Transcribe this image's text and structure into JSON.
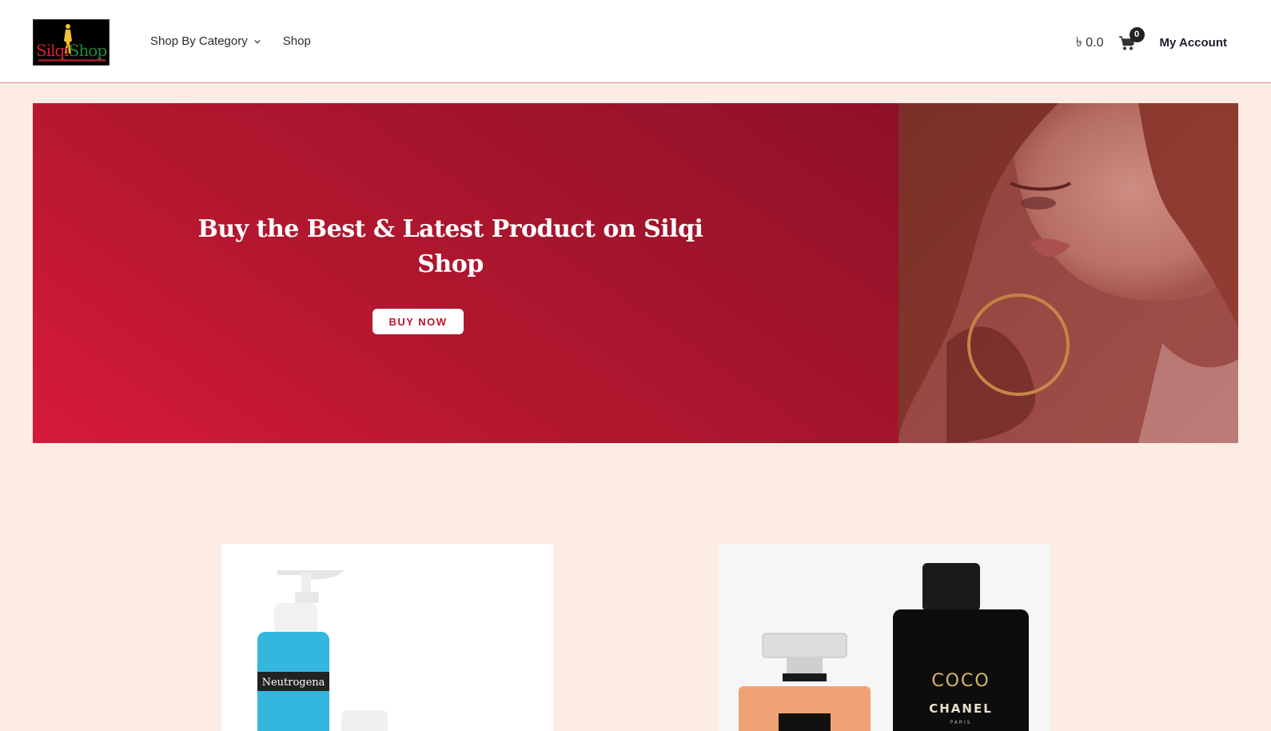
{
  "header": {
    "logo": {
      "text_red": "Silqi",
      "text_green": "Shop"
    },
    "nav": [
      {
        "label": "Shop By Category",
        "has_dropdown": true
      },
      {
        "label": "Shop",
        "has_dropdown": false
      }
    ],
    "cart_total": "৳ 0.0",
    "cart_count": "0",
    "account_label": "My Account"
  },
  "hero": {
    "title": "Buy the Best & Latest Product on Silqi Shop",
    "button_label": "BUY NOW"
  },
  "products": [
    {
      "brand_label": "Neutrogena"
    },
    {
      "brand_top": "COCO",
      "brand_bottom": "CHANEL",
      "brand_small": "PARIS"
    }
  ],
  "colors": {
    "hero_red": "#c0172f",
    "page_bg": "#fdece4",
    "header_border": "#e08a8a"
  },
  "icons": [
    "chevron-down-icon",
    "cart-icon"
  ]
}
